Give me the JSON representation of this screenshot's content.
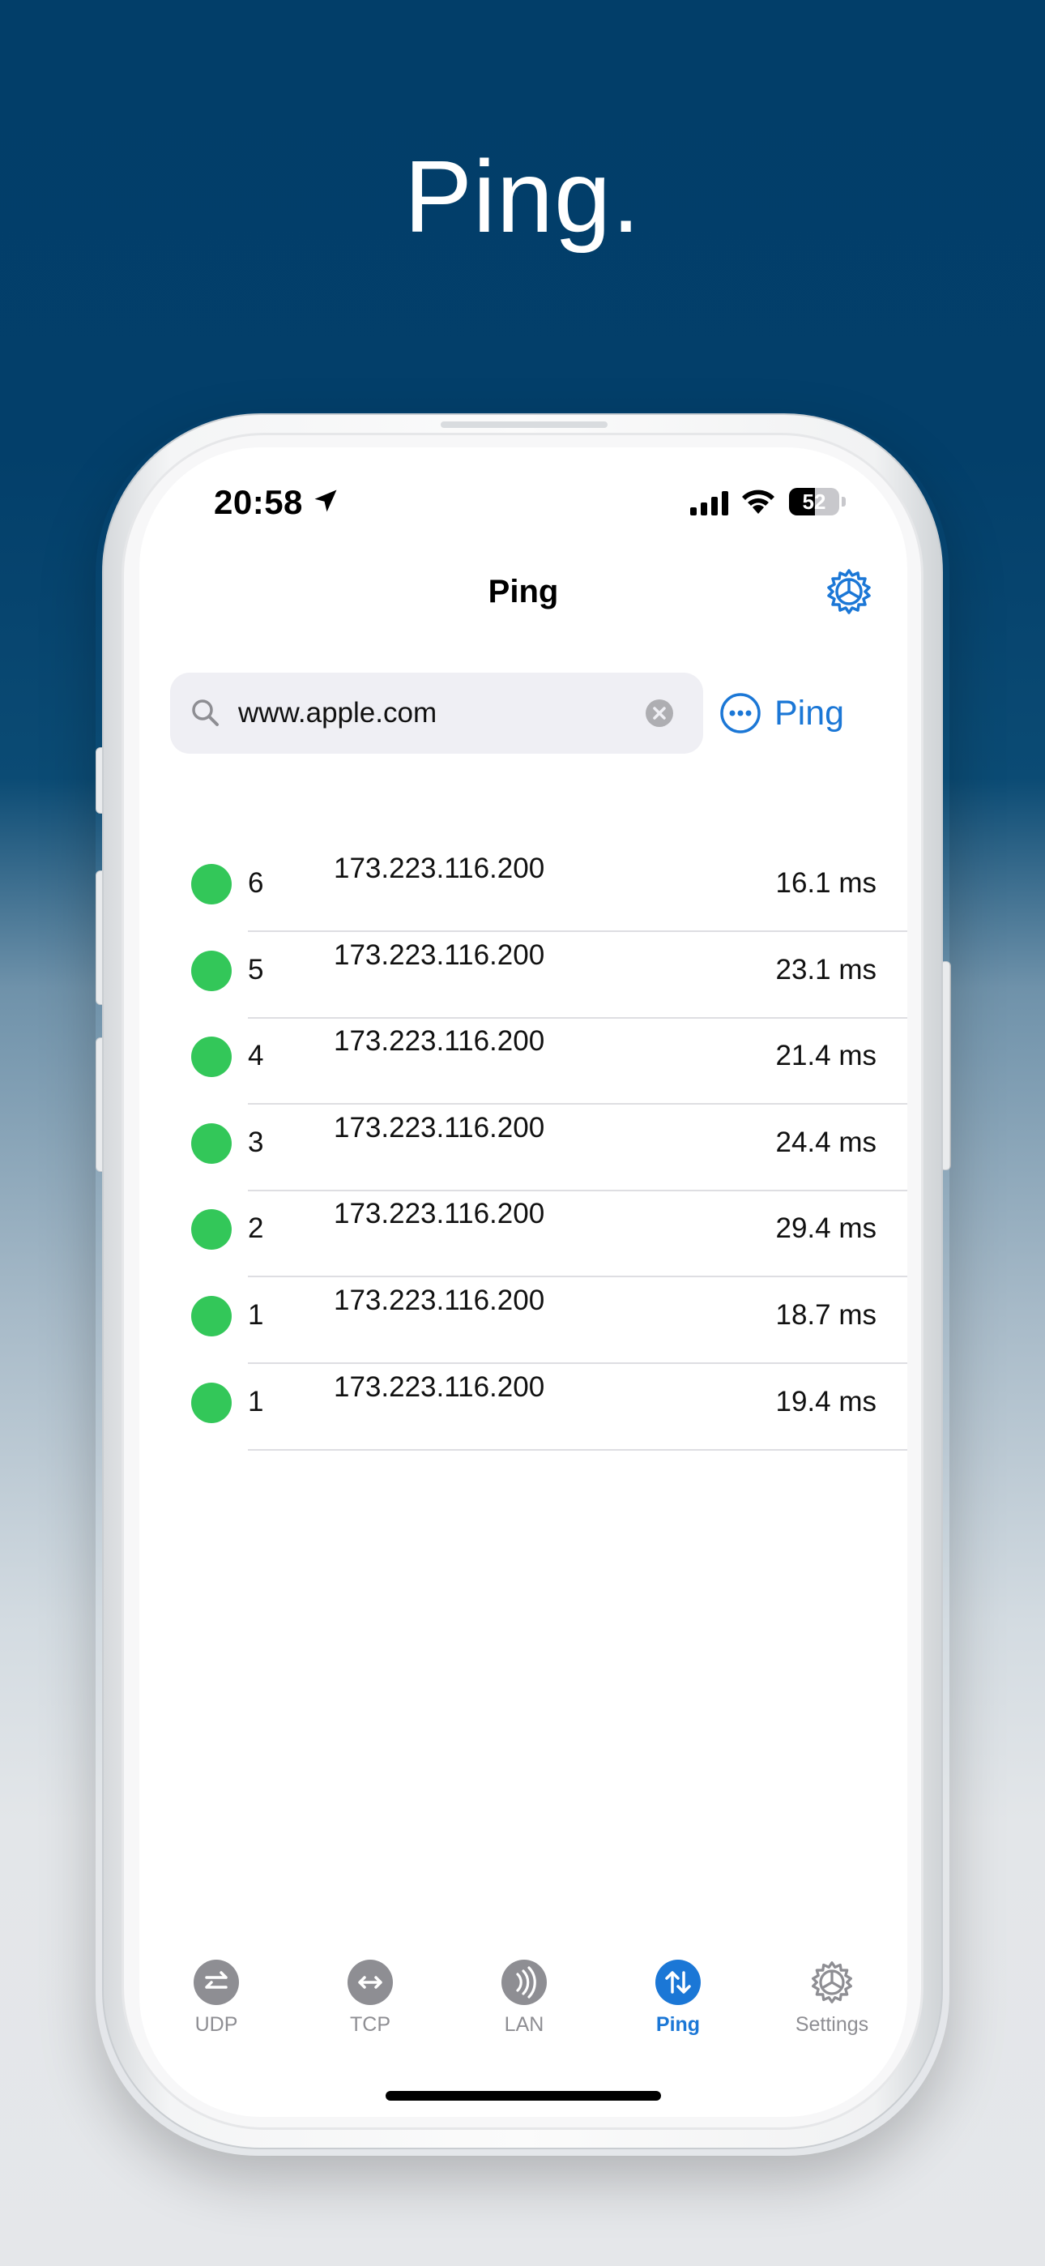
{
  "headline": "Ping.",
  "status_bar": {
    "time": "20:58",
    "battery_level": "52",
    "battery_fraction": 0.52
  },
  "nav": {
    "title": "Ping"
  },
  "search": {
    "value": "www.apple.com"
  },
  "ping_button_label": "Ping",
  "results": [
    {
      "seq": "6",
      "ip": "173.223.116.200",
      "time": "16.1 ms"
    },
    {
      "seq": "5",
      "ip": "173.223.116.200",
      "time": "23.1 ms"
    },
    {
      "seq": "4",
      "ip": "173.223.116.200",
      "time": "21.4 ms"
    },
    {
      "seq": "3",
      "ip": "173.223.116.200",
      "time": "24.4 ms"
    },
    {
      "seq": "2",
      "ip": "173.223.116.200",
      "time": "29.4 ms"
    },
    {
      "seq": "1",
      "ip": "173.223.116.200",
      "time": "18.7 ms"
    },
    {
      "seq": "1",
      "ip": "173.223.116.200",
      "time": "19.4 ms"
    }
  ],
  "tabs": [
    {
      "label": "UDP",
      "icon": "udp-arrows-icon",
      "active": false
    },
    {
      "label": "TCP",
      "icon": "tcp-arrows-icon",
      "active": false
    },
    {
      "label": "LAN",
      "icon": "lan-waves-icon",
      "active": false
    },
    {
      "label": "Ping",
      "icon": "ping-arrows-icon",
      "active": true
    },
    {
      "label": "Settings",
      "icon": "gear-icon",
      "active": false
    }
  ],
  "colors": {
    "accent": "#1b77d6",
    "status_ok": "#33c759",
    "inactive": "#8e8e93",
    "background_top": "#023e69"
  }
}
